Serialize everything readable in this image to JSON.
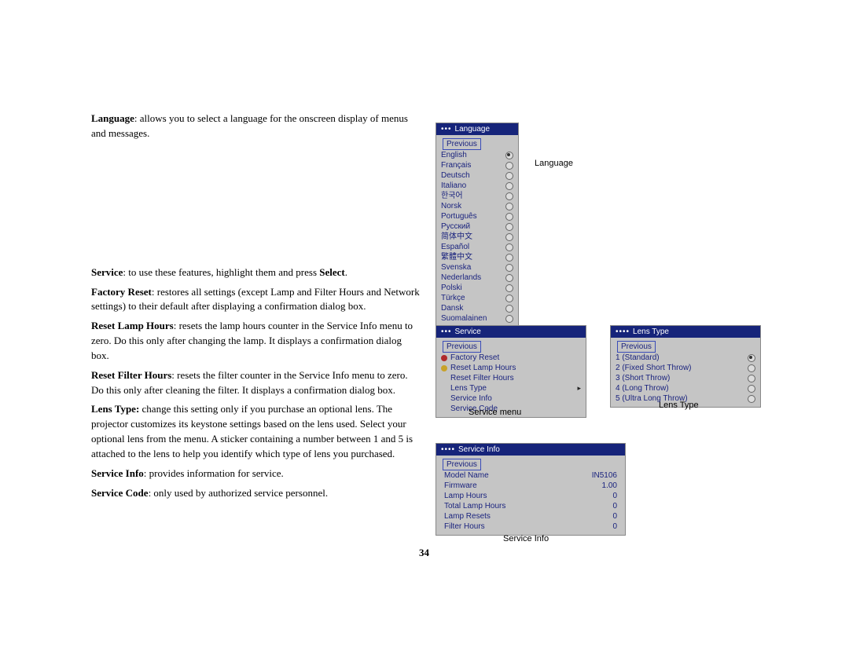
{
  "page_number": "34",
  "paragraphs": {
    "p1_bold": "Language",
    "p1_rest": ": allows you to select a language for the onscreen display of menus and messages.",
    "p2_bold": "Service",
    "p2_mid": ": to use these features, highlight them and press ",
    "p2_bold2": "Select",
    "p2_end": ".",
    "p3_bold": "Factory Reset",
    "p3_rest": ": restores all settings (except Lamp and Filter Hours and Network settings) to their default after displaying a confirmation dialog box.",
    "p4_bold": "Reset Lamp Hours",
    "p4_rest": ": resets the lamp hours counter in the Service Info menu to zero. Do this only after changing the lamp. It displays a confirmation dialog box.",
    "p5_bold": "Reset Filter Hours",
    "p5_rest": ": resets the filter counter in the Service Info menu to zero. Do this only after cleaning the filter. It displays a confirmation dialog box.",
    "p6_bold": "Lens Type:",
    "p6_rest": " change this setting only if you purchase an optional lens. The projector customizes its keystone settings based on the lens used. Select your optional lens from the menu. A sticker containing a number between 1 and 5 is attached to the lens to help you identify which type of lens you purchased.",
    "p7_bold": "Service Info",
    "p7_rest": ": provides information for service.",
    "p8_bold": "Service Code",
    "p8_rest": ": only used by authorized service personnel."
  },
  "captions": {
    "language": "Language",
    "service_menu": "Service menu",
    "lens_type": "Lens Type",
    "service_info": "Service Info"
  },
  "menus": {
    "language": {
      "dots": "•••",
      "title": "Language",
      "previous": "Previous",
      "items": [
        {
          "label": "English",
          "selected": true
        },
        {
          "label": "Français",
          "selected": false
        },
        {
          "label": "Deutsch",
          "selected": false
        },
        {
          "label": "Italiano",
          "selected": false
        },
        {
          "label": "한국어",
          "selected": false
        },
        {
          "label": "Norsk",
          "selected": false
        },
        {
          "label": "Português",
          "selected": false
        },
        {
          "label": "Русский",
          "selected": false
        },
        {
          "label": "简体中文",
          "selected": false
        },
        {
          "label": "Español",
          "selected": false
        },
        {
          "label": "繁體中文",
          "selected": false
        },
        {
          "label": "Svenska",
          "selected": false
        },
        {
          "label": "Nederlands",
          "selected": false
        },
        {
          "label": "Polski",
          "selected": false
        },
        {
          "label": "Türkçe",
          "selected": false
        },
        {
          "label": "Dansk",
          "selected": false
        },
        {
          "label": "Suomalainen",
          "selected": false
        }
      ]
    },
    "service": {
      "dots": "•••",
      "title": "Service",
      "previous": "Previous",
      "items": [
        {
          "icon": "red",
          "label": "Factory Reset"
        },
        {
          "icon": "yellow",
          "label": "Reset Lamp Hours"
        },
        {
          "icon": "",
          "label": "Reset Filter Hours"
        },
        {
          "icon": "",
          "label": "Lens Type",
          "arrow": true
        },
        {
          "icon": "",
          "label": "Service Info"
        },
        {
          "icon": "",
          "label": "Service Code"
        }
      ]
    },
    "lenstype": {
      "dots": "••••",
      "title": "Lens Type",
      "previous": "Previous",
      "items": [
        {
          "label": "1 (Standard)",
          "selected": true
        },
        {
          "label": "2 (Fixed Short Throw)",
          "selected": false
        },
        {
          "label": "3 (Short Throw)",
          "selected": false
        },
        {
          "label": "4 (Long Throw)",
          "selected": false
        },
        {
          "label": "5 (Ultra Long Throw)",
          "selected": false
        }
      ]
    },
    "serviceinfo": {
      "dots": "••••",
      "title": "Service Info",
      "previous": "Previous",
      "rows": [
        {
          "k": "Model Name",
          "v": "IN5106"
        },
        {
          "k": "Firmware",
          "v": "1.00"
        },
        {
          "k": "Lamp Hours",
          "v": "0"
        },
        {
          "k": "Total Lamp Hours",
          "v": "0"
        },
        {
          "k": "Lamp Resets",
          "v": "0"
        },
        {
          "k": "Filter Hours",
          "v": "0"
        }
      ]
    }
  }
}
